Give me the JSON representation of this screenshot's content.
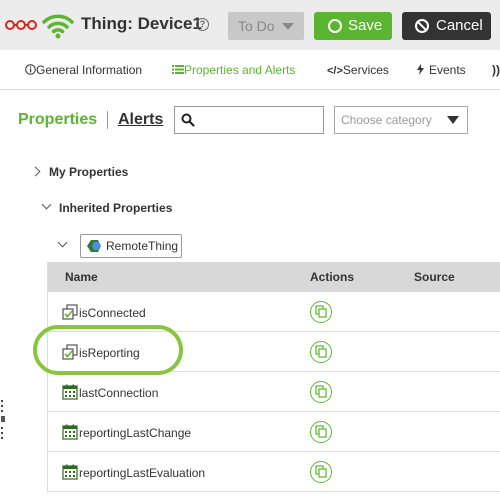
{
  "header": {
    "logo_icon": "thingworx-logo-icon",
    "connection_icon": "wifi-icon",
    "title": "Thing: Device1",
    "help_icon": "?",
    "state": {
      "selected": "To Do"
    },
    "save_label": "Save",
    "cancel_label": "Cancel",
    "accent": "#5cb531"
  },
  "tabs": [
    {
      "label": "General Information",
      "icon": "info-icon"
    },
    {
      "label": "Properties and Alerts",
      "icon": "list-icon",
      "active": true
    },
    {
      "label": "Services",
      "icon": "code-icon"
    },
    {
      "label": "Events",
      "icon": "lightning-icon"
    }
  ],
  "subnav": {
    "properties_label": "Properties",
    "alerts_label": "Alerts",
    "search": {
      "value": "",
      "placeholder": ""
    },
    "category": {
      "placeholder": "Choose category"
    }
  },
  "tree": {
    "my_properties": "My Properties",
    "inherited_properties": "Inherited Properties",
    "remote_thing": "RemoteThing"
  },
  "table": {
    "columns": [
      "Name",
      "Actions",
      "Source"
    ],
    "rows": [
      {
        "name": "isConnected",
        "icon": "checkbox-icon"
      },
      {
        "name": "isReporting",
        "icon": "checkbox-icon",
        "highlighted": true
      },
      {
        "name": "lastConnection",
        "icon": "calendar-icon"
      },
      {
        "name": "reportingLastChange",
        "icon": "calendar-icon"
      },
      {
        "name": "reportingLastEvaluation",
        "icon": "calendar-icon"
      }
    ]
  }
}
